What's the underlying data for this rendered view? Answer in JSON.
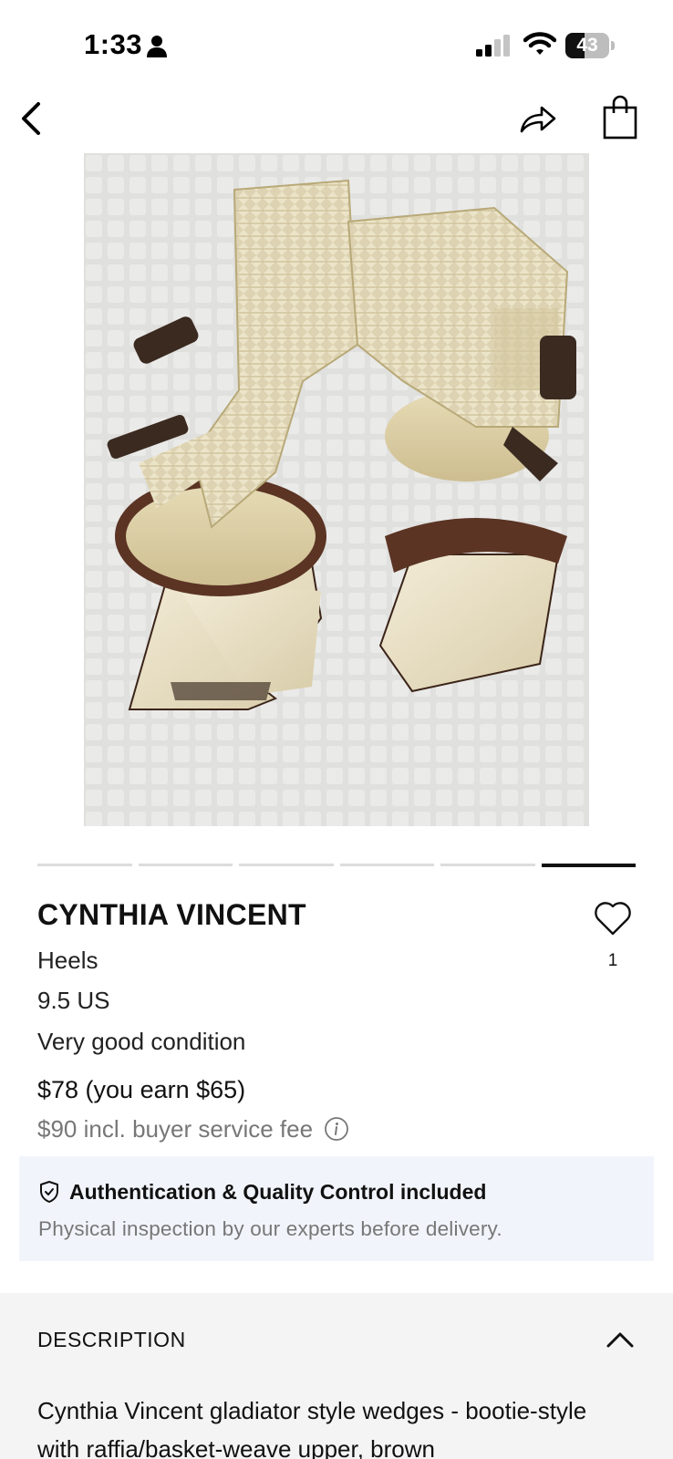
{
  "status_bar": {
    "time": "1:33",
    "battery": "43",
    "battery_level": 0.43,
    "icons": [
      "person-icon",
      "signal-icon",
      "wifi-icon",
      "battery-icon"
    ]
  },
  "nav": {
    "icons": [
      "back-arrow-icon",
      "share-icon",
      "shopping-bag-icon"
    ]
  },
  "gallery": {
    "image_count": 6,
    "active_index": 5
  },
  "product": {
    "brand": "CYNTHIA VINCENT",
    "likes": "1",
    "category": "Heels",
    "size": "9.5 US",
    "condition": "Very good condition",
    "price": "$78 (you earn $65)",
    "buyer_fee": "$90 incl. buyer service fee"
  },
  "authentication": {
    "title": "Authentication & Quality Control included",
    "subtitle": "Physical inspection by our experts before delivery."
  },
  "description": {
    "header": "DESCRIPTION",
    "text": "Cynthia Vincent gladiator style wedges - bootie-style with raffia/basket-weave upper, brown"
  },
  "colors": {
    "accent": "#111111",
    "muted_text": "#777777",
    "auth_bg": "#f1f5fb",
    "section_bg": "#f4f4f4"
  }
}
